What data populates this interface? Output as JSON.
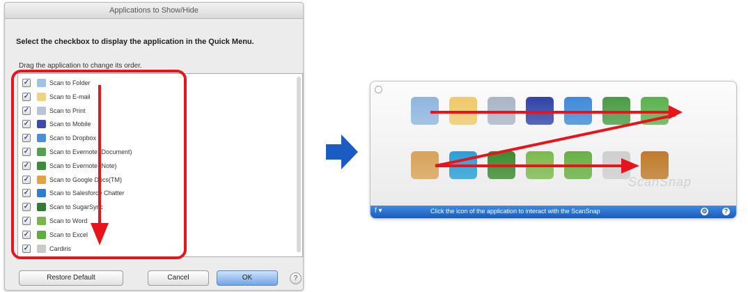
{
  "dialog": {
    "title": "Applications to Show/Hide",
    "instruction": "Select the checkbox to display the application in the Quick Menu.",
    "drag_hint": "Drag the application to change its order.",
    "items": [
      {
        "label": "Scan to Folder",
        "checked": true,
        "color": "#9fc3e8"
      },
      {
        "label": "Scan to E-mail",
        "checked": true,
        "color": "#f2d27a"
      },
      {
        "label": "Scan to Print",
        "checked": true,
        "color": "#b8c4d4"
      },
      {
        "label": "Scan to Mobile",
        "checked": true,
        "color": "#3b4cae"
      },
      {
        "label": "Scan to Dropbox",
        "checked": true,
        "color": "#4a90d9"
      },
      {
        "label": "Scan to Evernote (Document)",
        "checked": true,
        "color": "#4fa34a"
      },
      {
        "label": "Scan to Evernote (Note)",
        "checked": true,
        "color": "#3a8c38"
      },
      {
        "label": "Scan to Google Docs(TM)",
        "checked": true,
        "color": "#e6a23c"
      },
      {
        "label": "Scan to Salesforce Chatter",
        "checked": true,
        "color": "#2f7fd0"
      },
      {
        "label": "Scan to SugarSync",
        "checked": true,
        "color": "#2e7d32"
      },
      {
        "label": "Scan to Word",
        "checked": true,
        "color": "#7ab648"
      },
      {
        "label": "Scan to Excel",
        "checked": true,
        "color": "#5fae3c"
      },
      {
        "label": "Cardiris",
        "checked": true,
        "color": "#c9c9c9"
      }
    ],
    "buttons": {
      "restore": "Restore Default",
      "cancel": "Cancel",
      "ok": "OK",
      "help": "?"
    }
  },
  "quick_menu": {
    "brand": "ScanSnap",
    "bar_text": "Click the icon of the application to interact with the ScanSnap",
    "menu_glyph": "f ▾",
    "bar_icon_left": "⚙",
    "bar_icon_right": "?",
    "icons_row1": [
      {
        "name": "folder-icon",
        "color": "#8fb6df"
      },
      {
        "name": "email-icon",
        "color": "#f0c96a"
      },
      {
        "name": "print-icon",
        "color": "#aab6c6"
      },
      {
        "name": "mobile-icon",
        "color": "#3044a8"
      },
      {
        "name": "dropbox-icon",
        "color": "#3f8ad8"
      },
      {
        "name": "evernote-document-icon",
        "color": "#4a9b45"
      },
      {
        "name": "evernote-note-icon",
        "color": "#5cb04f"
      }
    ],
    "icons_row2": [
      {
        "name": "google-docs-icon",
        "color": "#d9a25a"
      },
      {
        "name": "salesforce-chatter-icon",
        "color": "#2a9fd6"
      },
      {
        "name": "sugarsync-icon",
        "color": "#3c8a2e"
      },
      {
        "name": "word-icon",
        "color": "#7cba4c"
      },
      {
        "name": "excel-icon",
        "color": "#68b044"
      },
      {
        "name": "cardiris-icon",
        "color": "#cfcfcf"
      },
      {
        "name": "photo-icon",
        "color": "#c07a2a"
      }
    ]
  },
  "colors": {
    "highlight": "#e8141b",
    "arrow_blue": "#1a5cc2"
  }
}
